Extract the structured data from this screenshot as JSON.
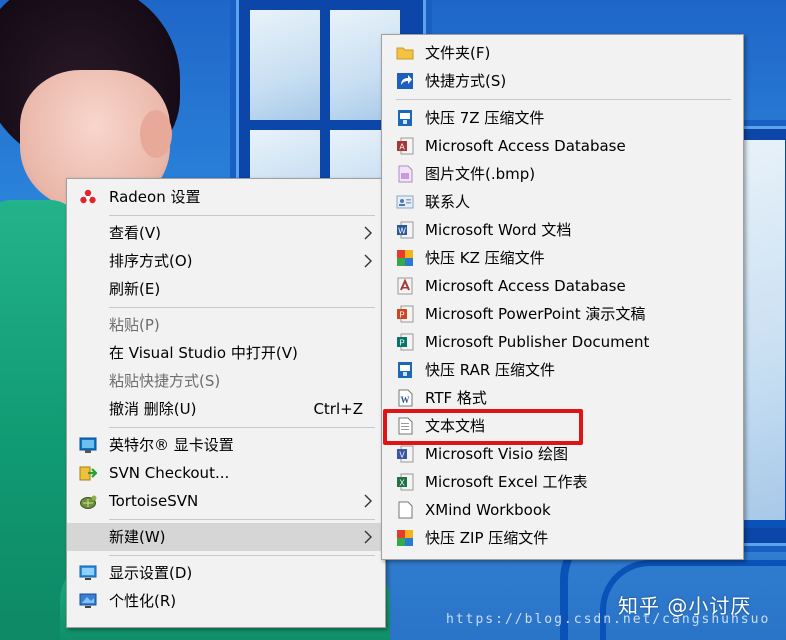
{
  "main_menu": {
    "items": [
      {
        "label": "Radeon 设置",
        "icon": "radeon-icon"
      },
      {
        "label": "查看(V)",
        "submenu": true
      },
      {
        "label": "排序方式(O)",
        "submenu": true
      },
      {
        "label": "刷新(E)"
      },
      {
        "label": "粘贴(P)",
        "disabled": true
      },
      {
        "label": "在 Visual Studio 中打开(V)"
      },
      {
        "label": "粘贴快捷方式(S)",
        "disabled": true
      },
      {
        "label": "撤消 删除(U)",
        "shortcut": "Ctrl+Z"
      },
      {
        "label": "英特尔® 显卡设置",
        "icon": "intel-graphics-icon"
      },
      {
        "label": "SVN Checkout...",
        "icon": "svn-checkout-icon"
      },
      {
        "label": "TortoiseSVN",
        "icon": "tortoisesvn-icon",
        "submenu": true
      },
      {
        "label": "新建(W)",
        "submenu": true,
        "highlighted": true
      },
      {
        "label": "显示设置(D)",
        "icon": "display-settings-icon"
      },
      {
        "label": "个性化(R)",
        "icon": "personalize-icon"
      }
    ]
  },
  "new_submenu": {
    "items": [
      {
        "label": "文件夹(F)",
        "icon": "folder-icon"
      },
      {
        "label": "快捷方式(S)",
        "icon": "shortcut-icon"
      },
      {
        "label": "快压 7Z 压缩文件",
        "icon": "kuaiya-7z-icon"
      },
      {
        "label": "Microsoft Access Database",
        "icon": "access-icon"
      },
      {
        "label": "图片文件(.bmp)",
        "icon": "bmp-icon"
      },
      {
        "label": "联系人",
        "icon": "contact-icon"
      },
      {
        "label": "Microsoft Word 文档",
        "icon": "word-icon"
      },
      {
        "label": "快压 KZ 压缩文件",
        "icon": "kuaiya-kz-icon"
      },
      {
        "label": "Microsoft Access Database",
        "icon": "access-icon-2"
      },
      {
        "label": "Microsoft PowerPoint 演示文稿",
        "icon": "powerpoint-icon"
      },
      {
        "label": "Microsoft Publisher Document",
        "icon": "publisher-icon"
      },
      {
        "label": "快压 RAR 压缩文件",
        "icon": "kuaiya-rar-icon"
      },
      {
        "label": "RTF 格式",
        "icon": "rtf-icon"
      },
      {
        "label": "文本文档",
        "icon": "text-document-icon"
      },
      {
        "label": "Microsoft Visio 绘图",
        "icon": "visio-icon"
      },
      {
        "label": "Microsoft Excel 工作表",
        "icon": "excel-icon"
      },
      {
        "label": "XMind Workbook",
        "icon": "xmind-icon"
      },
      {
        "label": "快压 ZIP 压缩文件",
        "icon": "kuaiya-zip-icon"
      }
    ]
  },
  "annotation": {
    "highlight_color": "#e01414"
  },
  "watermark": {
    "text": "知乎 @小讨厌",
    "url": "https://blog.csdn.net/cangshuhsuo"
  }
}
